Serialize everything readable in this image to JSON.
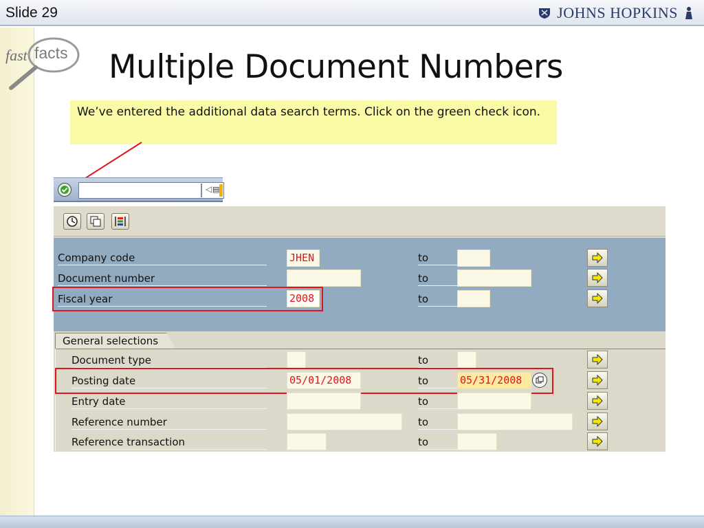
{
  "slide": {
    "number": "Slide 29",
    "brand": "JOHNS HOPKINS",
    "logo_fast": "fast",
    "logo_facts": "facts",
    "title": "Multiple Document Numbers",
    "callout": "We’ve entered the additional data search terms. Click on the green check icon."
  },
  "toolbar": {
    "command_value": "",
    "ok_icon": "green-check-icon"
  },
  "selection": {
    "to_label": "to",
    "fields": [
      {
        "label": "Company code",
        "from": "JHEN",
        "to": ""
      },
      {
        "label": "Document number",
        "from": "",
        "to": ""
      },
      {
        "label": "Fiscal year",
        "from": "2008",
        "to": ""
      }
    ],
    "group_title": "General selections",
    "general": [
      {
        "label": "Document type",
        "from": "",
        "to": ""
      },
      {
        "label": "Posting date",
        "from": "05/01/2008",
        "to": "05/31/2008"
      },
      {
        "label": "Entry date",
        "from": "",
        "to": ""
      },
      {
        "label": "Reference number",
        "from": "",
        "to": ""
      },
      {
        "label": "Reference transaction",
        "from": "",
        "to": ""
      }
    ]
  },
  "colors": {
    "highlight_box": "#e0141c",
    "field_value": "#e5131d",
    "callout_bg": "#fafaa6"
  }
}
